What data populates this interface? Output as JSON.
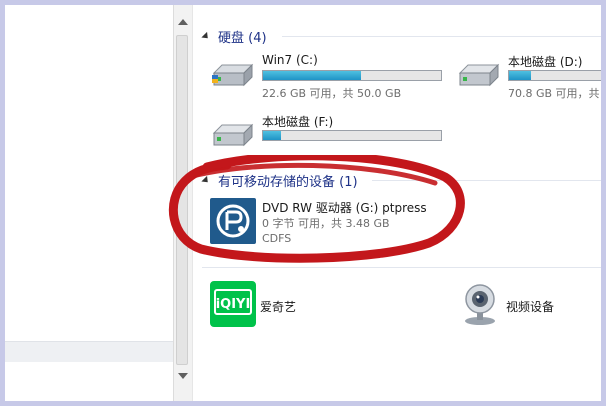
{
  "groups": {
    "hard_disk": "硬盘 (4)",
    "removable": "有可移动存储的设备 (1)"
  },
  "drives": [
    {
      "name": "Win7 (C:)",
      "free_text": "22.6 GB 可用，共 50.0 GB",
      "used_fraction": 0.55
    },
    {
      "name": "本地磁盘 (D:)",
      "free_text": "70.8 GB 可用，共",
      "used_fraction": 0.2
    },
    {
      "name": "本地磁盘 (F:)",
      "free_text": "",
      "used_fraction": 0.1
    }
  ],
  "dvd": {
    "name": "DVD RW 驱动器 (G:) ptpress",
    "free_text": "0 字节 可用，共 3.48 GB",
    "filesystem": "CDFS"
  },
  "apps": [
    {
      "label": "爱奇艺",
      "icon_text": "iQIYI"
    },
    {
      "label": "视频设备"
    }
  ],
  "colors": {
    "header_text": "#1e3287",
    "bar_fill": "#1f94c6",
    "annotation_red": "#c3171b",
    "iqiyi_green": "#00c24a"
  }
}
